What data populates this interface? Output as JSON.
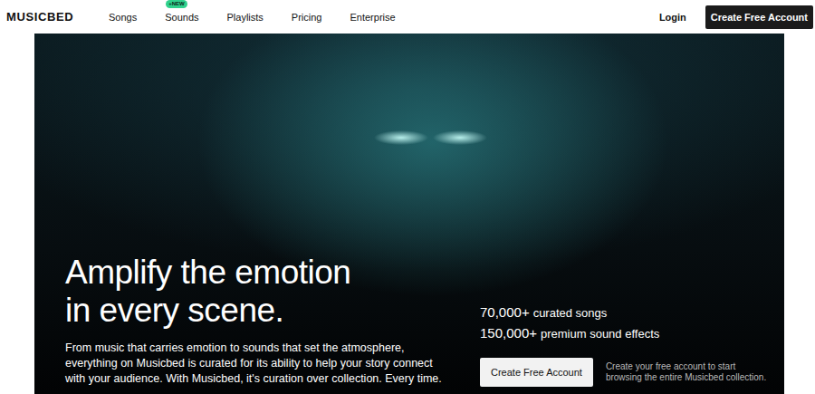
{
  "nav": {
    "logo": "MUSICBED",
    "links": [
      {
        "label": "Songs",
        "badge": ""
      },
      {
        "label": "Sounds",
        "badge": "+NEW"
      },
      {
        "label": "Playlists",
        "badge": ""
      },
      {
        "label": "Pricing",
        "badge": ""
      },
      {
        "label": "Enterprise",
        "badge": ""
      }
    ],
    "login": "Login",
    "cta": "Create Free Account"
  },
  "hero": {
    "headline": "Amplify the emotion in every scene.",
    "body": "From music that carries emotion to sounds that set the atmosphere, everything on Musicbed is curated for its ability to help your story connect with your audience. With Musicbed, it's curation over collection. Every time.",
    "stats": [
      {
        "value": "70,000+",
        "label": "curated songs"
      },
      {
        "value": "150,000+",
        "label": "premium sound effects"
      }
    ],
    "button": "Create Free Account",
    "note": "Create your free account to start browsing the entire Musicbed collection."
  }
}
